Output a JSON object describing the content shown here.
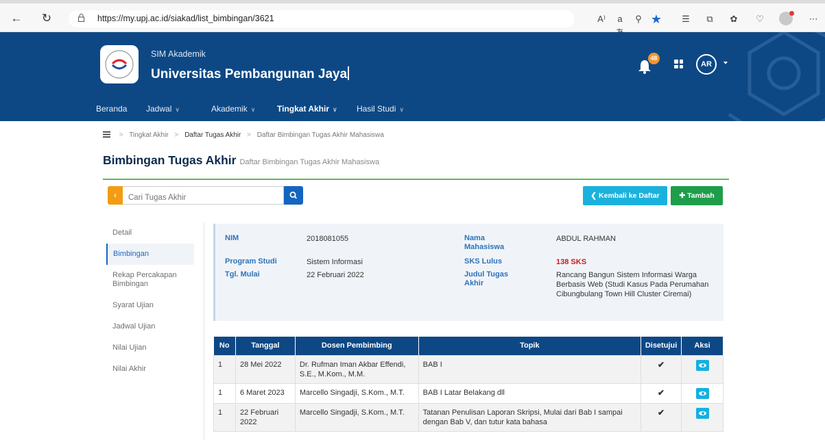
{
  "browser": {
    "url": "https://my.upj.ac.id/siakad/list_bimbingan/3621",
    "read_aloud_label": "A⁾",
    "translate_label": "aあ"
  },
  "header": {
    "app_label": "SIM Akademik",
    "university": "Universitas Pembangunan Jaya",
    "notification_count": "48",
    "avatar_initials": "AR",
    "colors": {
      "primary": "#0d4885",
      "badge": "#f4932c"
    }
  },
  "menu": {
    "items": [
      {
        "label": "Beranda",
        "dropdown": false
      },
      {
        "label": "Jadwal",
        "dropdown": true
      },
      {
        "label": "Akademik",
        "dropdown": true
      },
      {
        "label": "Tingkat Akhir",
        "dropdown": true,
        "active": true
      },
      {
        "label": "Hasil Studi",
        "dropdown": true
      }
    ]
  },
  "breadcrumb": {
    "items": [
      "Tingkat Akhir",
      "Daftar Tugas Akhir",
      "Daftar Bimbingan Tugas Akhir Mahasiswa"
    ]
  },
  "page": {
    "title": "Bimbingan Tugas Akhir",
    "subtitle": "Daftar Bimbingan Tugas Akhir Mahasiswa"
  },
  "toolbar": {
    "search_placeholder": "Cari Tugas Akhir",
    "back_label": "Kembali ke Daftar",
    "add_label": "Tambah",
    "colors": {
      "back": "#1ab2dd",
      "add": "#1e9e4a",
      "toggle": "#f39c12"
    }
  },
  "side_menu": {
    "items": [
      {
        "label": "Detail",
        "active": false
      },
      {
        "label": "Bimbingan",
        "active": true
      },
      {
        "label": "Rekap Percakapan Bimbingan",
        "active": false
      },
      {
        "label": "Syarat Ujian",
        "active": false
      },
      {
        "label": "Jadwal Ujian",
        "active": false
      },
      {
        "label": "Nilai Ujian",
        "active": false
      },
      {
        "label": "Nilai Akhir",
        "active": false
      }
    ]
  },
  "student": {
    "nim_label": "NIM",
    "nim": "2018081055",
    "nama_label": "Nama Mahasiswa",
    "nama": "ABDUL RAHMAN",
    "prodi_label": "Program Studi",
    "prodi": "Sistem Informasi",
    "sks_label": "SKS Lulus",
    "sks": "138 SKS",
    "tgl_label": "Tgl. Mulai",
    "tgl": "22 Februari 2022",
    "judul_label": "Judul Tugas Akhir",
    "judul": "Rancang Bangun Sistem Informasi Warga Berbasis Web (Studi Kasus Pada Perumahan Cibungbulang Town Hill Cluster Ciremai)"
  },
  "table": {
    "headers": [
      "No",
      "Tanggal",
      "Dosen Pembimbing",
      "Topik",
      "Disetujui",
      "Aksi"
    ],
    "rows": [
      {
        "no": "1",
        "tanggal": "28 Mei 2022",
        "dosen": "Dr. Rufman Iman Akbar Effendi, S.E., M.Kom., M.M.",
        "topik": "BAB I",
        "disetujui": "✔"
      },
      {
        "no": "1",
        "tanggal": "6 Maret 2023",
        "dosen": "Marcello Singadji, S.Kom., M.T.",
        "topik": "BAB I Latar Belakang dll",
        "disetujui": "✔"
      },
      {
        "no": "1",
        "tanggal": "22 Februari 2022",
        "dosen": "Marcello Singadji, S.Kom., M.T.",
        "topik": "Tatanan Penulisan Laporan Skripsi, Mulai dari Bab I sampai dengan Bab V, dan tutur kata bahasa",
        "disetujui": "✔"
      }
    ]
  }
}
